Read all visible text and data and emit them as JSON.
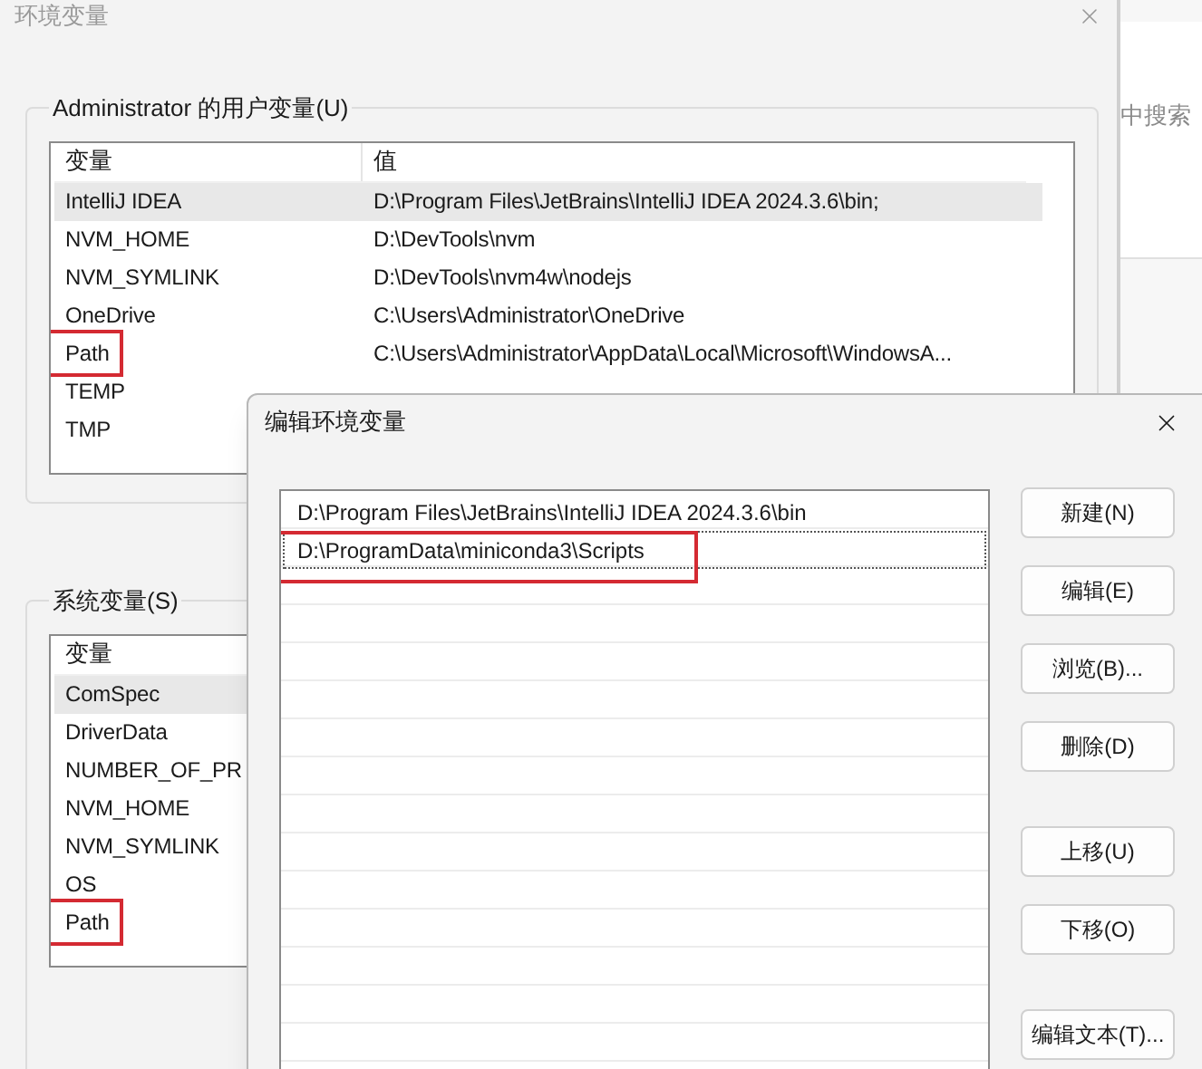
{
  "main_window": {
    "title": "环境变量",
    "user_vars": {
      "label": "Administrator 的用户变量(U)",
      "columns": [
        "变量",
        "值"
      ],
      "rows": [
        {
          "name": "IntelliJ IDEA",
          "value": "D:\\Program Files\\JetBrains\\IntelliJ IDEA 2024.3.6\\bin;",
          "selected": true,
          "highlighted": false
        },
        {
          "name": "NVM_HOME",
          "value": "D:\\DevTools\\nvm",
          "selected": false,
          "highlighted": false
        },
        {
          "name": "NVM_SYMLINK",
          "value": "D:\\DevTools\\nvm4w\\nodejs",
          "selected": false,
          "highlighted": false
        },
        {
          "name": "OneDrive",
          "value": "C:\\Users\\Administrator\\OneDrive",
          "selected": false,
          "highlighted": false
        },
        {
          "name": "Path",
          "value": "C:\\Users\\Administrator\\AppData\\Local\\Microsoft\\WindowsA...",
          "selected": false,
          "highlighted": true
        },
        {
          "name": "TEMP",
          "selected": false,
          "highlighted": false
        },
        {
          "name": "TMP",
          "selected": false,
          "highlighted": false
        }
      ]
    },
    "system_vars": {
      "label": "系统变量(S)",
      "columns": [
        "变量"
      ],
      "rows": [
        {
          "name": "ComSpec",
          "selected": true,
          "highlighted": false
        },
        {
          "name": "DriverData",
          "selected": false,
          "highlighted": false
        },
        {
          "name": "NUMBER_OF_PR",
          "selected": false,
          "highlighted": false
        },
        {
          "name": "NVM_HOME",
          "selected": false,
          "highlighted": false
        },
        {
          "name": "NVM_SYMLINK",
          "selected": false,
          "highlighted": false
        },
        {
          "name": "OS",
          "selected": false,
          "highlighted": false
        },
        {
          "name": "Path",
          "selected": false,
          "highlighted": true
        }
      ]
    }
  },
  "background_window": {
    "text": "中搜索"
  },
  "dialog": {
    "title": "编辑环境变量",
    "entries": [
      {
        "text": "D:\\Program Files\\JetBrains\\IntelliJ IDEA 2024.3.6\\bin",
        "selected": false,
        "highlighted": false
      },
      {
        "text": "D:\\ProgramData\\miniconda3\\Scripts",
        "selected": true,
        "highlighted": true
      }
    ],
    "button_groups": [
      [
        "新建(N)",
        "编辑(E)",
        "浏览(B)...",
        "删除(D)"
      ],
      [
        "上移(U)",
        "下移(O)"
      ],
      [
        "编辑文本(T)..."
      ]
    ]
  }
}
